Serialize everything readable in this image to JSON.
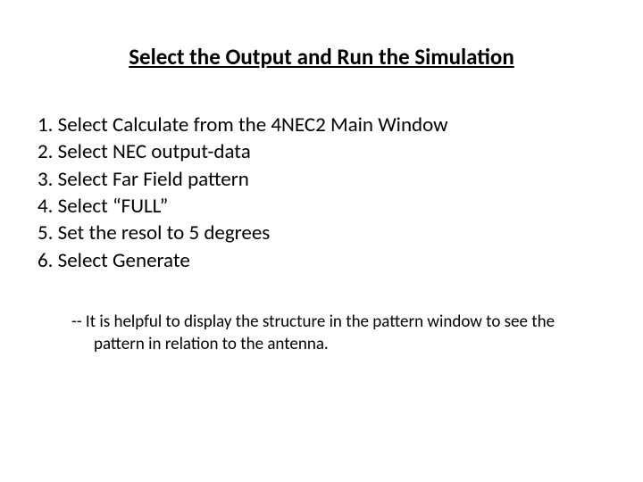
{
  "title": "Select the Output and Run the Simulation",
  "steps": [
    "1. Select Calculate from the 4NEC2 Main Window",
    "2.  Select NEC output-data",
    "3.  Select Far Field pattern",
    "4.  Select “FULL”",
    "5.  Set the resol to 5 degrees",
    "6.   Select Generate"
  ],
  "note": "--  It is helpful to display the structure in the pattern window to see the pattern in relation to the antenna."
}
